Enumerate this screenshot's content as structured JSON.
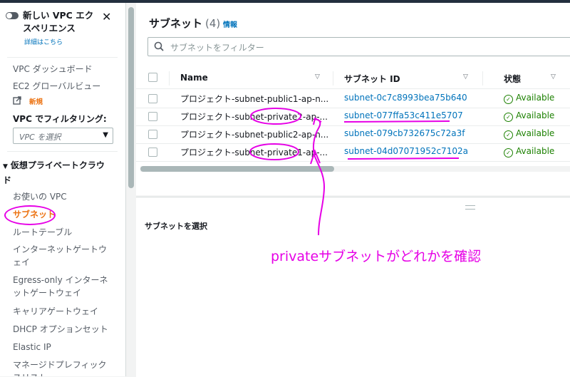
{
  "sidebar": {
    "toggle_label": "新しい VPC エクスペリエンス",
    "detail_link": "詳細はこちら",
    "nav_top": [
      {
        "label": "VPC ダッシュボード"
      },
      {
        "label": "EC2 グローバルビュー",
        "badge": "新規"
      }
    ],
    "filter_label": "VPC でフィルタリング:",
    "vpc_select_placeholder": "VPC を選択",
    "section_title": "仮想プライベートクラウド",
    "section_items": [
      {
        "label": "お使いの VPC"
      },
      {
        "label": "サブネット",
        "active": true
      },
      {
        "label": "ルートテーブル"
      },
      {
        "label": "インターネットゲートウェイ"
      },
      {
        "label": "Egress-only インターネットゲートウェイ"
      },
      {
        "label": "キャリアゲートウェイ"
      },
      {
        "label": "DHCP オプションセット"
      },
      {
        "label": "Elastic IP"
      },
      {
        "label": "マネージドプレフィックスリスト"
      }
    ]
  },
  "main": {
    "title": "サブネット",
    "count": "(4)",
    "info_link": "情報",
    "search_placeholder": "サブネットをフィルター",
    "columns": {
      "name": "Name",
      "subnet_id": "サブネット ID",
      "state": "状態"
    },
    "rows": [
      {
        "name": "プロジェクト-subnet-public1-ap-n...",
        "subnet_id": "subnet-0c7c8993bea75b640",
        "state": "Available"
      },
      {
        "name": "プロジェクト-subnet-private2-ap-...",
        "subnet_id": "subnet-077ffa53c411e5707",
        "state": "Available"
      },
      {
        "name": "プロジェクト-subnet-public2-ap-n...",
        "subnet_id": "subnet-079cb732675c72a3f",
        "state": "Available"
      },
      {
        "name": "プロジェクト-subnet-private1-ap-...",
        "subnet_id": "subnet-04d07071952c7102a",
        "state": "Available"
      }
    ]
  },
  "lower_panel": {
    "title": "サブネットを選択"
  },
  "annotation": {
    "text": "privateサブネットがどれかを確認",
    "color": "#e600e6"
  },
  "colors": {
    "accent_orange": "#ec7211",
    "link_blue": "#0073bb",
    "status_green": "#1d8102",
    "dark_header": "#232f3e"
  }
}
